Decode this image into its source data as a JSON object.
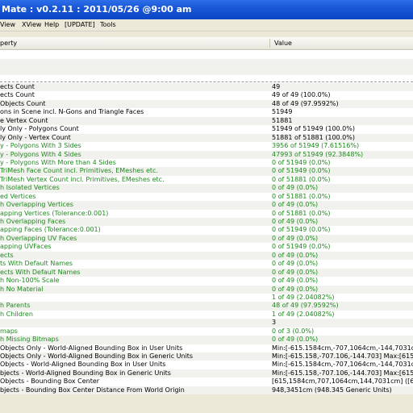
{
  "window": {
    "title": "Mate : v0.2.11 : 2011/05/26 @9:00 am"
  },
  "menu": [
    {
      "label": "View"
    },
    {
      "label": "XView"
    },
    {
      "label": "Help"
    },
    {
      "label": "[UPDATE]"
    },
    {
      "label": "Tools"
    }
  ],
  "table": {
    "headers": {
      "property": "perty",
      "value": "Value"
    },
    "rows": [
      {
        "property": "ects Count",
        "value": "49",
        "status": "normal"
      },
      {
        "property": "ects Count",
        "value": "49 of 49 (100.0%)",
        "status": "normal"
      },
      {
        "property": "Objects Count",
        "value": "48 of 49 (97.9592%)",
        "status": "normal"
      },
      {
        "property": "ons in Scene incl. N-Gons and Triangle Faces",
        "value": "51949",
        "status": "normal"
      },
      {
        "property": "e Vertex Count",
        "value": "51881",
        "status": "normal"
      },
      {
        "property": "ly Only - Polygons Count",
        "value": "51949 of 51949 (100.0%)",
        "status": "normal"
      },
      {
        "property": "ly Only - Vertex Count",
        "value": "51881 of 51881 (100.0%)",
        "status": "normal"
      },
      {
        "property": "y - Polygons With 3 Sides",
        "value": "3956 of 51949 (7.61516%)",
        "status": "green"
      },
      {
        "property": "y - Polygons With 4 Sides",
        "value": "47993 of 51949 (92.3848%)",
        "status": "green"
      },
      {
        "property": "y - Polygons With More than 4 Sides",
        "value": "0 of 51949 (0.0%)",
        "status": "green"
      },
      {
        "property": "TriMesh Face Count incl. Primitives, EMeshes etc.",
        "value": "0 of 51949 (0.0%)",
        "status": "green"
      },
      {
        "property": "TriMesh Vertex Count incl. Primitives, EMeshes etc.",
        "value": "0 of 51881 (0.0%)",
        "status": "green"
      },
      {
        "property": "h Isolated Vertices",
        "value": "0 of 49 (0.0%)",
        "status": "green"
      },
      {
        "property": "ed Vertices",
        "value": "0 of 51881 (0.0%)",
        "status": "green"
      },
      {
        "property": "h Overlapping Vertices",
        "value": "0 of 49 (0.0%)",
        "status": "green"
      },
      {
        "property": "apping Vertices (Tolerance:0.001)",
        "value": "0 of 51881 (0.0%)",
        "status": "green"
      },
      {
        "property": "h Overlapping Faces",
        "value": "0 of 49 (0.0%)",
        "status": "green"
      },
      {
        "property": "apping Faces (Tolerance:0.001)",
        "value": "0 of 51949 (0.0%)",
        "status": "green"
      },
      {
        "property": "h Overlapping UV Faces",
        "value": "0 of 49 (0.0%)",
        "status": "green"
      },
      {
        "property": "apping UVFaces",
        "value": "0 of 51949 (0.0%)",
        "status": "green"
      },
      {
        "property": "ects",
        "value": "0 of 49 (0.0%)",
        "status": "green"
      },
      {
        "property": "ts With Default Names",
        "value": "0 of 49 (0.0%)",
        "status": "green"
      },
      {
        "property": "ects With Default Names",
        "value": "0 of 49 (0.0%)",
        "status": "green"
      },
      {
        "property": "h Non-100% Scale",
        "value": "0 of 49 (0.0%)",
        "status": "green"
      },
      {
        "property": "h No Material",
        "value": "0 of 49 (0.0%)",
        "status": "green"
      },
      {
        "property": "",
        "value": "1 of 49 (2.04082%)",
        "status": "green"
      },
      {
        "property": "h Parents",
        "value": "48 of 49 (97.9592%)",
        "status": "green"
      },
      {
        "property": "h Children",
        "value": "1 of 49 (2.04082%)",
        "status": "green"
      },
      {
        "property": "",
        "value": "3",
        "status": "normal"
      },
      {
        "property": "maps",
        "value": "0 of 3 (0.0%)",
        "status": "green"
      },
      {
        "property": "h Missing Bitmaps",
        "value": "0 of 49 (0.0%)",
        "status": "green"
      },
      {
        "property": "Objects Only - World-Aligned Bounding Box in User Units",
        "value": "Min:[-615.1584cm,-707,1064cm,-144,7031cm]   Max:[615.",
        "status": "normal"
      },
      {
        "property": "Objects Only - World-Aligned Bounding Box in Generic Units",
        "value": "Min:[-615.158,-707.106,-144.703]  Max:[615.15",
        "status": "normal"
      },
      {
        "property": "Objects - World-Aligned Bounding Box in User Units",
        "value": "Min:[-615.1584cm,-707,1064cm,-144,7031cm]  Max:[615.1",
        "status": "normal"
      },
      {
        "property": "bjects - World-Aligned Bounding Box in Generic Units",
        "value": "Min:[-615.158,-707.106,-144.703]  Max:[615.15",
        "status": "normal"
      },
      {
        "property": "Objects - Bounding Box Center",
        "value": "[615,1584cm,707,1064cm,144,7031cm]   ([615.15",
        "status": "normal"
      },
      {
        "property": "bjects - Bounding Box Center Distance From World Origin",
        "value": "948,3451cm  (948.345 Generic Units)",
        "status": "normal"
      }
    ]
  }
}
